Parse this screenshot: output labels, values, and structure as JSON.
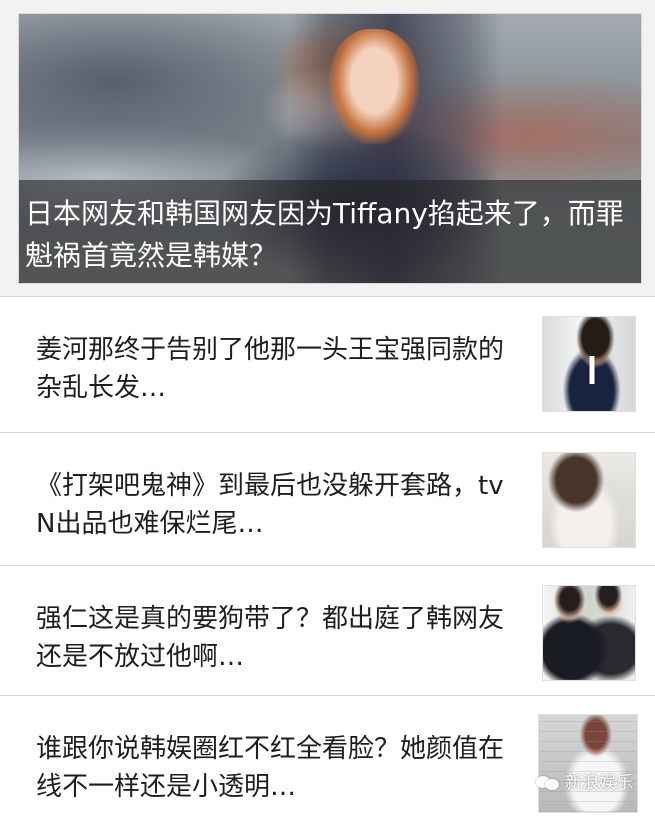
{
  "hero": {
    "caption": "日本网友和韩国网友因为Tiffany掐起来了，而罪魁祸首竟然是韩媒？"
  },
  "news": {
    "items": [
      {
        "title": "姜河那终于告别了他那一头王宝强同款的杂乱长发…"
      },
      {
        "title": "《打架吧鬼神》到最后也没躲开套路，tvN出品也难保烂尾…"
      },
      {
        "title": "强仁这是真的要狗带了？都出庭了韩网友还是不放过他啊…"
      },
      {
        "title": "谁跟你说韩娱圈红不红全看脸？她颜值在线不一样还是小透明…"
      }
    ]
  },
  "watermark": {
    "label": "新浪娱乐"
  }
}
